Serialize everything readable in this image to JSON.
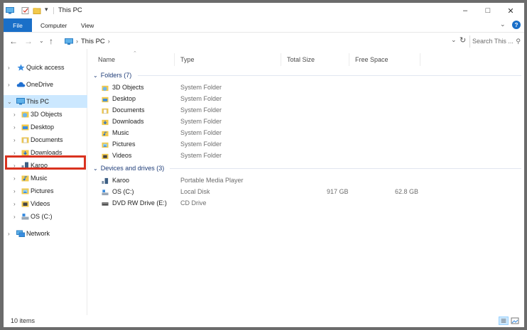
{
  "window": {
    "title": "This PC"
  },
  "ribbon": {
    "tabs": [
      "File",
      "Computer",
      "View"
    ],
    "help": "?"
  },
  "address": {
    "crumb": "This PC",
    "search_placeholder": "Search This ..."
  },
  "nav": {
    "items": [
      {
        "label": "Quick access",
        "icon": "star-icon",
        "level": 0
      },
      {
        "label": "OneDrive",
        "icon": "cloud-icon",
        "level": 0
      },
      {
        "label": "This PC",
        "icon": "pc-icon",
        "level": 0,
        "selected": true
      },
      {
        "label": "3D Objects",
        "icon": "cube-folder-icon",
        "level": 1
      },
      {
        "label": "Desktop",
        "icon": "desktop-folder-icon",
        "level": 1
      },
      {
        "label": "Documents",
        "icon": "documents-folder-icon",
        "level": 1
      },
      {
        "label": "Downloads",
        "icon": "downloads-folder-icon",
        "level": 1
      },
      {
        "label": "Karoo",
        "icon": "media-player-icon",
        "level": 1,
        "highlighted": true
      },
      {
        "label": "Music",
        "icon": "music-folder-icon",
        "level": 1
      },
      {
        "label": "Pictures",
        "icon": "pictures-folder-icon",
        "level": 1
      },
      {
        "label": "Videos",
        "icon": "videos-folder-icon",
        "level": 1
      },
      {
        "label": "OS (C:)",
        "icon": "drive-icon",
        "level": 1
      },
      {
        "label": "Network",
        "icon": "network-icon",
        "level": 0
      }
    ]
  },
  "columns": {
    "name": "Name",
    "type": "Type",
    "total": "Total Size",
    "free": "Free Space"
  },
  "groups": {
    "folders": {
      "header": "Folders (7)",
      "rows": [
        {
          "name": "3D Objects",
          "type": "System Folder"
        },
        {
          "name": "Desktop",
          "type": "System Folder"
        },
        {
          "name": "Documents",
          "type": "System Folder"
        },
        {
          "name": "Downloads",
          "type": "System Folder"
        },
        {
          "name": "Music",
          "type": "System Folder"
        },
        {
          "name": "Pictures",
          "type": "System Folder"
        },
        {
          "name": "Videos",
          "type": "System Folder"
        }
      ]
    },
    "devices": {
      "header": "Devices and drives (3)",
      "rows": [
        {
          "name": "Karoo",
          "type": "Portable Media Player",
          "total": "",
          "free": ""
        },
        {
          "name": "OS (C:)",
          "type": "Local Disk",
          "total": "917 GB",
          "free": "62.8 GB"
        },
        {
          "name": "DVD RW Drive (E:)",
          "type": "CD Drive",
          "total": "",
          "free": ""
        }
      ]
    }
  },
  "status": {
    "items": "10 items"
  },
  "colors": {
    "accent": "#1a6fc8",
    "selection": "#cce8ff",
    "highlight": "#d9321f",
    "group": "#1e3c78"
  }
}
